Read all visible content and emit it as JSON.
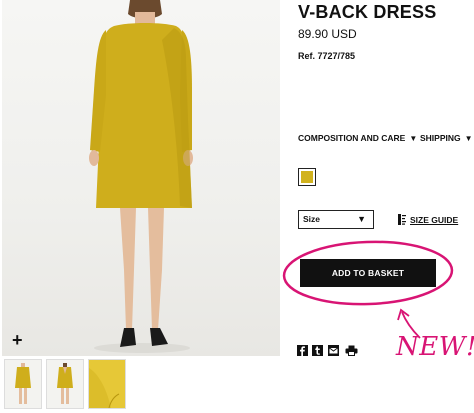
{
  "product": {
    "title": "V-BACK DRESS",
    "price": "89.90 USD",
    "reference": "Ref. 7727/785"
  },
  "gallery": {
    "zoom_label": "+",
    "thumbnails": [
      "front-view",
      "back-view",
      "fabric-detail"
    ]
  },
  "info_links": {
    "composition_label": "COMPOSITION AND CARE",
    "shipping_label": "SHIPPING"
  },
  "color": {
    "selected_swatch": "#d1b21e"
  },
  "size": {
    "select_label": "Size",
    "guide_label": "SIZE GUIDE"
  },
  "basket": {
    "button_label": "ADD TO BASKET"
  },
  "share": {
    "icons": [
      "facebook-icon",
      "tumblr-icon",
      "email-icon",
      "print-icon"
    ]
  },
  "annotation": {
    "new_text": "NEW!",
    "color": "#d81474"
  },
  "colors": {
    "dress": "#cfae1c",
    "dress_shadow": "#b8970f",
    "button": "#111111"
  }
}
